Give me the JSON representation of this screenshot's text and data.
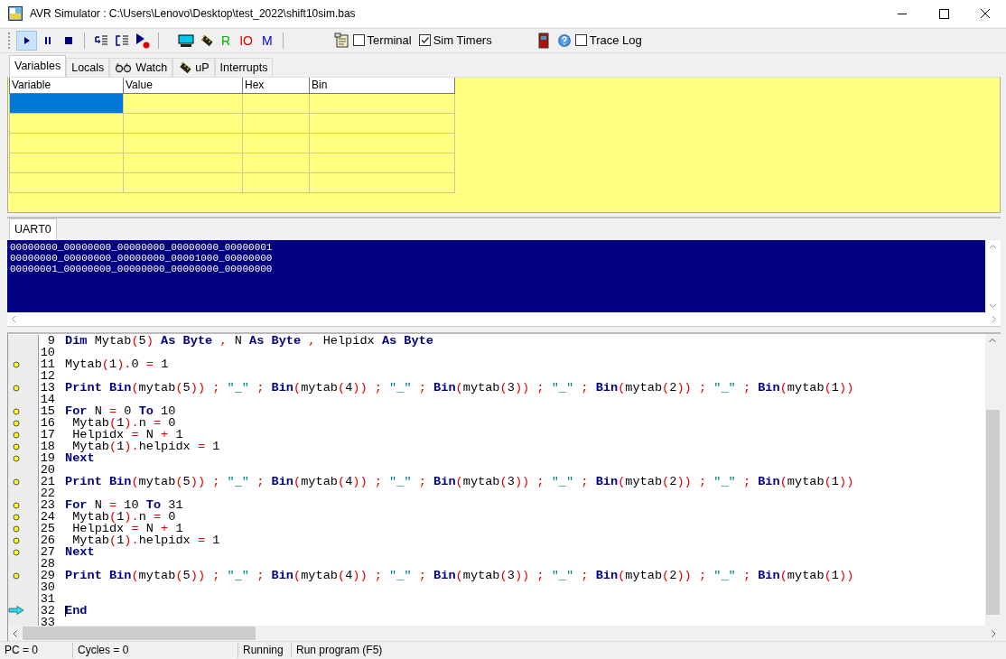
{
  "window": {
    "title": "AVR Simulator : C:\\Users\\Lenovo\\Desktop\\test_2022\\shift10sim.bas"
  },
  "toolbar": [
    {
      "kind": "run",
      "selected": true
    },
    {
      "kind": "pause",
      "selected": false
    },
    {
      "kind": "stop",
      "selected": false
    },
    {
      "kind": "separator"
    },
    {
      "kind": "step",
      "selected": false
    },
    {
      "kind": "stepover",
      "selected": false
    },
    {
      "kind": "runto",
      "selected": false
    },
    {
      "kind": "separator"
    },
    {
      "kind": "lcd",
      "selected": false
    },
    {
      "kind": "chip",
      "selected": false
    },
    {
      "kind": "letter",
      "text": "R",
      "color": "#00b000"
    },
    {
      "kind": "letter",
      "text": "IO",
      "color": "#e00000"
    },
    {
      "kind": "letter",
      "text": "M",
      "color": "#0000e0"
    },
    {
      "kind": "separator"
    },
    {
      "kind": "notepad",
      "selected": false
    },
    {
      "kind": "checkbox",
      "label": "Terminal",
      "checked": false
    },
    {
      "kind": "checkbox",
      "label": "Sim Timers",
      "checked": true
    },
    {
      "kind": "door",
      "selected": false
    },
    {
      "kind": "help",
      "selected": false
    },
    {
      "kind": "checkbox",
      "label": "Trace Log",
      "checked": false
    }
  ],
  "tabs": [
    {
      "label": "Variables",
      "selected": true
    },
    {
      "label": "Locals",
      "selected": false
    },
    {
      "label": "Watch",
      "selected": false
    },
    {
      "label": "uP",
      "selected": false
    },
    {
      "label": "Interrupts",
      "selected": false
    }
  ],
  "table": {
    "columns": [
      "Variable",
      "Value",
      "Hex",
      "Bin"
    ],
    "rows": [
      {
        "selected": true
      },
      {
        "selected": false
      },
      {
        "selected": false
      },
      {
        "selected": false
      },
      {
        "selected": false
      }
    ]
  },
  "uart": {
    "tab": "UART0",
    "lines": [
      "00000000_00000000_00000000_00000000_00000001",
      "00000000_00000000_00000000_00001000_00000000",
      "00000001_00000000_00000000_00000000_00000000"
    ]
  },
  "code": [
    {
      "num": "9",
      "breakpoint": false,
      "current": false,
      "tokens": [
        {
          "kind": "kw",
          "text": "Dim"
        },
        {
          "kind": "txt",
          "text": " Mytab"
        },
        {
          "kind": "op",
          "text": "("
        },
        {
          "kind": "txt",
          "text": "5"
        },
        {
          "kind": "op",
          "text": ") "
        },
        {
          "kind": "kw",
          "text": "As Byte"
        },
        {
          "kind": "op",
          "text": " , "
        },
        {
          "kind": "txt",
          "text": "N "
        },
        {
          "kind": "kw",
          "text": "As Byte"
        },
        {
          "kind": "op",
          "text": " , "
        },
        {
          "kind": "txt",
          "text": "Helpidx "
        },
        {
          "kind": "kw",
          "text": "As Byte"
        }
      ]
    },
    {
      "num": "10",
      "breakpoint": false,
      "current": false
    },
    {
      "num": "11",
      "breakpoint": true,
      "current": false,
      "tokens": [
        {
          "kind": "txt",
          "text": "Mytab"
        },
        {
          "kind": "op",
          "text": "("
        },
        {
          "kind": "txt",
          "text": "1"
        },
        {
          "kind": "op",
          "text": ")."
        },
        {
          "kind": "txt",
          "text": "0 "
        },
        {
          "kind": "op",
          "text": "= "
        },
        {
          "kind": "txt",
          "text": "1"
        }
      ]
    },
    {
      "num": "12",
      "breakpoint": false,
      "current": false
    },
    {
      "num": "13",
      "breakpoint": true,
      "current": false,
      "tokens": [
        {
          "kind": "kw",
          "text": "Print "
        },
        {
          "kind": "kw",
          "text": "Bin"
        },
        {
          "kind": "op",
          "text": "("
        },
        {
          "kind": "txt",
          "text": "mytab"
        },
        {
          "kind": "op",
          "text": "("
        },
        {
          "kind": "txt",
          "text": "5"
        },
        {
          "kind": "op",
          "text": ")) ; "
        },
        {
          "kind": "str",
          "text": "\"_\""
        },
        {
          "kind": "op",
          "text": " ; "
        },
        {
          "kind": "kw",
          "text": "Bin"
        },
        {
          "kind": "op",
          "text": "("
        },
        {
          "kind": "txt",
          "text": "mytab"
        },
        {
          "kind": "op",
          "text": "("
        },
        {
          "kind": "txt",
          "text": "4"
        },
        {
          "kind": "op",
          "text": ")) ; "
        },
        {
          "kind": "str",
          "text": "\"_\""
        },
        {
          "kind": "op",
          "text": " ; "
        },
        {
          "kind": "kw",
          "text": "Bin"
        },
        {
          "kind": "op",
          "text": "("
        },
        {
          "kind": "txt",
          "text": "mytab"
        },
        {
          "kind": "op",
          "text": "("
        },
        {
          "kind": "txt",
          "text": "3"
        },
        {
          "kind": "op",
          "text": ")) ; "
        },
        {
          "kind": "str",
          "text": "\"_\""
        },
        {
          "kind": "op",
          "text": " ; "
        },
        {
          "kind": "kw",
          "text": "Bin"
        },
        {
          "kind": "op",
          "text": "("
        },
        {
          "kind": "txt",
          "text": "mytab"
        },
        {
          "kind": "op",
          "text": "("
        },
        {
          "kind": "txt",
          "text": "2"
        },
        {
          "kind": "op",
          "text": ")) ; "
        },
        {
          "kind": "str",
          "text": "\"_\""
        },
        {
          "kind": "op",
          "text": " ; "
        },
        {
          "kind": "kw",
          "text": "Bin"
        },
        {
          "kind": "op",
          "text": "("
        },
        {
          "kind": "txt",
          "text": "mytab"
        },
        {
          "kind": "op",
          "text": "("
        },
        {
          "kind": "txt",
          "text": "1"
        },
        {
          "kind": "op",
          "text": "))"
        }
      ]
    },
    {
      "num": "14",
      "breakpoint": false,
      "current": false
    },
    {
      "num": "15",
      "breakpoint": true,
      "current": false,
      "tokens": [
        {
          "kind": "kw",
          "text": "For"
        },
        {
          "kind": "txt",
          "text": " N "
        },
        {
          "kind": "op",
          "text": "= "
        },
        {
          "kind": "txt",
          "text": "0 "
        },
        {
          "kind": "kw",
          "text": "To"
        },
        {
          "kind": "txt",
          "text": " 10"
        }
      ]
    },
    {
      "num": "16",
      "breakpoint": true,
      "current": false,
      "tokens": [
        {
          "kind": "txt",
          "text": " Mytab"
        },
        {
          "kind": "op",
          "text": "("
        },
        {
          "kind": "txt",
          "text": "1"
        },
        {
          "kind": "op",
          "text": ")."
        },
        {
          "kind": "txt",
          "text": "n "
        },
        {
          "kind": "op",
          "text": "= "
        },
        {
          "kind": "txt",
          "text": "0"
        }
      ]
    },
    {
      "num": "17",
      "breakpoint": true,
      "current": false,
      "tokens": [
        {
          "kind": "txt",
          "text": " Helpidx "
        },
        {
          "kind": "op",
          "text": "= "
        },
        {
          "kind": "txt",
          "text": "N "
        },
        {
          "kind": "op",
          "text": "+ "
        },
        {
          "kind": "txt",
          "text": "1"
        }
      ]
    },
    {
      "num": "18",
      "breakpoint": true,
      "current": false,
      "tokens": [
        {
          "kind": "txt",
          "text": " Mytab"
        },
        {
          "kind": "op",
          "text": "("
        },
        {
          "kind": "txt",
          "text": "1"
        },
        {
          "kind": "op",
          "text": ")."
        },
        {
          "kind": "txt",
          "text": "helpidx "
        },
        {
          "kind": "op",
          "text": "= "
        },
        {
          "kind": "txt",
          "text": "1"
        }
      ]
    },
    {
      "num": "19",
      "breakpoint": true,
      "current": false,
      "tokens": [
        {
          "kind": "kw",
          "text": "Next"
        }
      ]
    },
    {
      "num": "20",
      "breakpoint": false,
      "current": false
    },
    {
      "num": "21",
      "breakpoint": true,
      "current": false,
      "tokens": [
        {
          "kind": "kw",
          "text": "Print "
        },
        {
          "kind": "kw",
          "text": "Bin"
        },
        {
          "kind": "op",
          "text": "("
        },
        {
          "kind": "txt",
          "text": "mytab"
        },
        {
          "kind": "op",
          "text": "("
        },
        {
          "kind": "txt",
          "text": "5"
        },
        {
          "kind": "op",
          "text": ")) ; "
        },
        {
          "kind": "str",
          "text": "\"_\""
        },
        {
          "kind": "op",
          "text": " ; "
        },
        {
          "kind": "kw",
          "text": "Bin"
        },
        {
          "kind": "op",
          "text": "("
        },
        {
          "kind": "txt",
          "text": "mytab"
        },
        {
          "kind": "op",
          "text": "("
        },
        {
          "kind": "txt",
          "text": "4"
        },
        {
          "kind": "op",
          "text": ")) ; "
        },
        {
          "kind": "str",
          "text": "\"_\""
        },
        {
          "kind": "op",
          "text": " ; "
        },
        {
          "kind": "kw",
          "text": "Bin"
        },
        {
          "kind": "op",
          "text": "("
        },
        {
          "kind": "txt",
          "text": "mytab"
        },
        {
          "kind": "op",
          "text": "("
        },
        {
          "kind": "txt",
          "text": "3"
        },
        {
          "kind": "op",
          "text": ")) ; "
        },
        {
          "kind": "str",
          "text": "\"_\""
        },
        {
          "kind": "op",
          "text": " ; "
        },
        {
          "kind": "kw",
          "text": "Bin"
        },
        {
          "kind": "op",
          "text": "("
        },
        {
          "kind": "txt",
          "text": "mytab"
        },
        {
          "kind": "op",
          "text": "("
        },
        {
          "kind": "txt",
          "text": "2"
        },
        {
          "kind": "op",
          "text": ")) ; "
        },
        {
          "kind": "str",
          "text": "\"_\""
        },
        {
          "kind": "op",
          "text": " ; "
        },
        {
          "kind": "kw",
          "text": "Bin"
        },
        {
          "kind": "op",
          "text": "("
        },
        {
          "kind": "txt",
          "text": "mytab"
        },
        {
          "kind": "op",
          "text": "("
        },
        {
          "kind": "txt",
          "text": "1"
        },
        {
          "kind": "op",
          "text": "))"
        }
      ]
    },
    {
      "num": "22",
      "breakpoint": false,
      "current": false
    },
    {
      "num": "23",
      "breakpoint": true,
      "current": false,
      "tokens": [
        {
          "kind": "kw",
          "text": "For"
        },
        {
          "kind": "txt",
          "text": " N "
        },
        {
          "kind": "op",
          "text": "= "
        },
        {
          "kind": "txt",
          "text": "10 "
        },
        {
          "kind": "kw",
          "text": "To"
        },
        {
          "kind": "txt",
          "text": " 31"
        }
      ]
    },
    {
      "num": "24",
      "breakpoint": true,
      "current": false,
      "tokens": [
        {
          "kind": "txt",
          "text": " Mytab"
        },
        {
          "kind": "op",
          "text": "("
        },
        {
          "kind": "txt",
          "text": "1"
        },
        {
          "kind": "op",
          "text": ")."
        },
        {
          "kind": "txt",
          "text": "n "
        },
        {
          "kind": "op",
          "text": "= "
        },
        {
          "kind": "txt",
          "text": "0"
        }
      ]
    },
    {
      "num": "25",
      "breakpoint": true,
      "current": false,
      "tokens": [
        {
          "kind": "txt",
          "text": " Helpidx "
        },
        {
          "kind": "op",
          "text": "= "
        },
        {
          "kind": "txt",
          "text": "N "
        },
        {
          "kind": "op",
          "text": "+ "
        },
        {
          "kind": "txt",
          "text": "1"
        }
      ]
    },
    {
      "num": "26",
      "breakpoint": true,
      "current": false,
      "tokens": [
        {
          "kind": "txt",
          "text": " Mytab"
        },
        {
          "kind": "op",
          "text": "("
        },
        {
          "kind": "txt",
          "text": "1"
        },
        {
          "kind": "op",
          "text": ")."
        },
        {
          "kind": "txt",
          "text": "helpidx "
        },
        {
          "kind": "op",
          "text": "= "
        },
        {
          "kind": "txt",
          "text": "1"
        }
      ]
    },
    {
      "num": "27",
      "breakpoint": true,
      "current": false,
      "tokens": [
        {
          "kind": "kw",
          "text": "Next"
        }
      ]
    },
    {
      "num": "28",
      "breakpoint": false,
      "current": false
    },
    {
      "num": "29",
      "breakpoint": true,
      "current": false,
      "tokens": [
        {
          "kind": "kw",
          "text": "Print "
        },
        {
          "kind": "kw",
          "text": "Bin"
        },
        {
          "kind": "op",
          "text": "("
        },
        {
          "kind": "txt",
          "text": "mytab"
        },
        {
          "kind": "op",
          "text": "("
        },
        {
          "kind": "txt",
          "text": "5"
        },
        {
          "kind": "op",
          "text": ")) ; "
        },
        {
          "kind": "str",
          "text": "\"_\""
        },
        {
          "kind": "op",
          "text": " ; "
        },
        {
          "kind": "kw",
          "text": "Bin"
        },
        {
          "kind": "op",
          "text": "("
        },
        {
          "kind": "txt",
          "text": "mytab"
        },
        {
          "kind": "op",
          "text": "("
        },
        {
          "kind": "txt",
          "text": "4"
        },
        {
          "kind": "op",
          "text": ")) ; "
        },
        {
          "kind": "str",
          "text": "\"_\""
        },
        {
          "kind": "op",
          "text": " ; "
        },
        {
          "kind": "kw",
          "text": "Bin"
        },
        {
          "kind": "op",
          "text": "("
        },
        {
          "kind": "txt",
          "text": "mytab"
        },
        {
          "kind": "op",
          "text": "("
        },
        {
          "kind": "txt",
          "text": "3"
        },
        {
          "kind": "op",
          "text": ")) ; "
        },
        {
          "kind": "str",
          "text": "\"_\""
        },
        {
          "kind": "op",
          "text": " ; "
        },
        {
          "kind": "kw",
          "text": "Bin"
        },
        {
          "kind": "op",
          "text": "("
        },
        {
          "kind": "txt",
          "text": "mytab"
        },
        {
          "kind": "op",
          "text": "("
        },
        {
          "kind": "txt",
          "text": "2"
        },
        {
          "kind": "op",
          "text": ")) ; "
        },
        {
          "kind": "str",
          "text": "\"_\""
        },
        {
          "kind": "op",
          "text": " ; "
        },
        {
          "kind": "kw",
          "text": "Bin"
        },
        {
          "kind": "op",
          "text": "("
        },
        {
          "kind": "txt",
          "text": "mytab"
        },
        {
          "kind": "op",
          "text": "("
        },
        {
          "kind": "txt",
          "text": "1"
        },
        {
          "kind": "op",
          "text": "))"
        }
      ]
    },
    {
      "num": "30",
      "breakpoint": false,
      "current": false
    },
    {
      "num": "31",
      "breakpoint": false,
      "current": false
    },
    {
      "num": "32",
      "breakpoint": false,
      "current": true,
      "tokens": [
        {
          "kind": "kw",
          "text": "End"
        }
      ]
    },
    {
      "num": "33",
      "breakpoint": false,
      "current": false
    }
  ],
  "status_bar": [
    "PC = 0",
    "Cycles = 0",
    "Running",
    "Run program (F5)"
  ]
}
